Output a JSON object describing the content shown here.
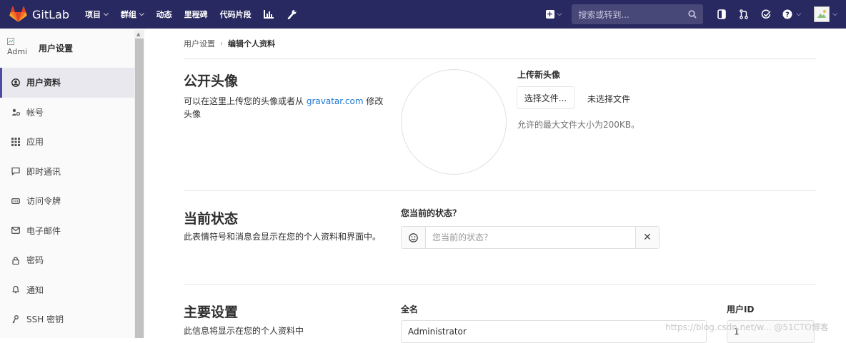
{
  "topbar": {
    "brand": "GitLab",
    "nav": [
      {
        "label": "项目",
        "dropdown": true
      },
      {
        "label": "群组",
        "dropdown": true
      },
      {
        "label": "动态",
        "dropdown": false
      },
      {
        "label": "里程碑",
        "dropdown": false
      },
      {
        "label": "代码片段",
        "dropdown": false
      }
    ],
    "search_placeholder": "搜索或转到...",
    "colors": {
      "header_bg": "#292961",
      "logo_orange": "#e24329"
    }
  },
  "sidebar": {
    "avatar_alt": "Admi",
    "title": "用户设置",
    "items": [
      {
        "label": "用户资料",
        "icon": "profile-icon",
        "active": true
      },
      {
        "label": "帐号",
        "icon": "account-icon",
        "active": false
      },
      {
        "label": "应用",
        "icon": "applications-icon",
        "active": false
      },
      {
        "label": "即时通讯",
        "icon": "chat-icon",
        "active": false
      },
      {
        "label": "访问令牌",
        "icon": "token-icon",
        "active": false
      },
      {
        "label": "电子邮件",
        "icon": "email-icon",
        "active": false
      },
      {
        "label": "密码",
        "icon": "lock-icon",
        "active": false
      },
      {
        "label": "通知",
        "icon": "bell-icon",
        "active": false
      },
      {
        "label": "SSH 密钥",
        "icon": "key-icon",
        "active": false
      }
    ]
  },
  "breadcrumb": {
    "parent": "用户设置",
    "current": "编辑个人资料"
  },
  "avatar_section": {
    "title": "公开头像",
    "desc_before": "可以在这里上传您的头像或者从 ",
    "desc_link": "gravatar.com",
    "desc_after": " 修改头像",
    "upload_label": "上传新头像",
    "choose_button": "选择文件...",
    "no_file": "未选择文件",
    "max_size": "允许的最大文件大小为200KB。"
  },
  "status_section": {
    "title": "当前状态",
    "desc": "此表情符号和消息会显示在您的个人资料和界面中。",
    "field_label": "您当前的状态？",
    "placeholder": "您当前的状态？"
  },
  "main_section": {
    "title": "主要设置",
    "desc": "此信息将显示在您的个人资料中",
    "name_label": "全名",
    "name_value": "Administrator",
    "uid_label": "用户ID",
    "uid_value": "1"
  },
  "watermark": "https://blog.csdn.net/w... @51CTO博客"
}
